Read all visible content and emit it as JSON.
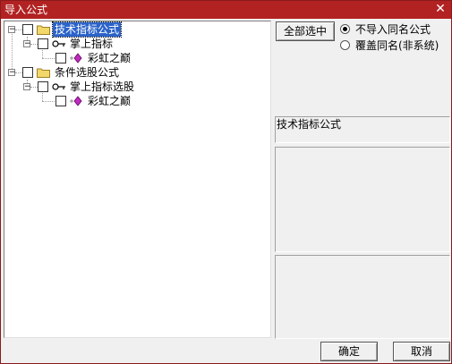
{
  "window": {
    "title": "导入公式",
    "close_glyph": "✕"
  },
  "tree": {
    "nodes": [
      {
        "label": "技术指标公式",
        "expander": "−",
        "icon": "folder-icon",
        "selected": true
      },
      {
        "label": "掌上指标",
        "expander": "−",
        "icon": "key-icon"
      },
      {
        "label": "彩虹之巅",
        "icon": "gem-icon"
      },
      {
        "label": "条件选股公式",
        "expander": "−",
        "icon": "folder-icon"
      },
      {
        "label": "掌上指标选股",
        "expander": "−",
        "icon": "key-icon"
      },
      {
        "label": "彩虹之巅",
        "icon": "gem-icon"
      }
    ]
  },
  "options": {
    "select_all_label": "全部选中",
    "radio_skip_label": "不导入同名公式",
    "radio_overwrite_label": "覆盖同名(非系统)",
    "selected_radio": "skip"
  },
  "info": {
    "category_text": "技术指标公式"
  },
  "footer": {
    "ok_label": "确定",
    "cancel_label": "取消"
  },
  "colors": {
    "titlebar": "#b22222",
    "selection": "#2b63c9",
    "folder": "#f2d86a",
    "gem": "#c02abf"
  }
}
